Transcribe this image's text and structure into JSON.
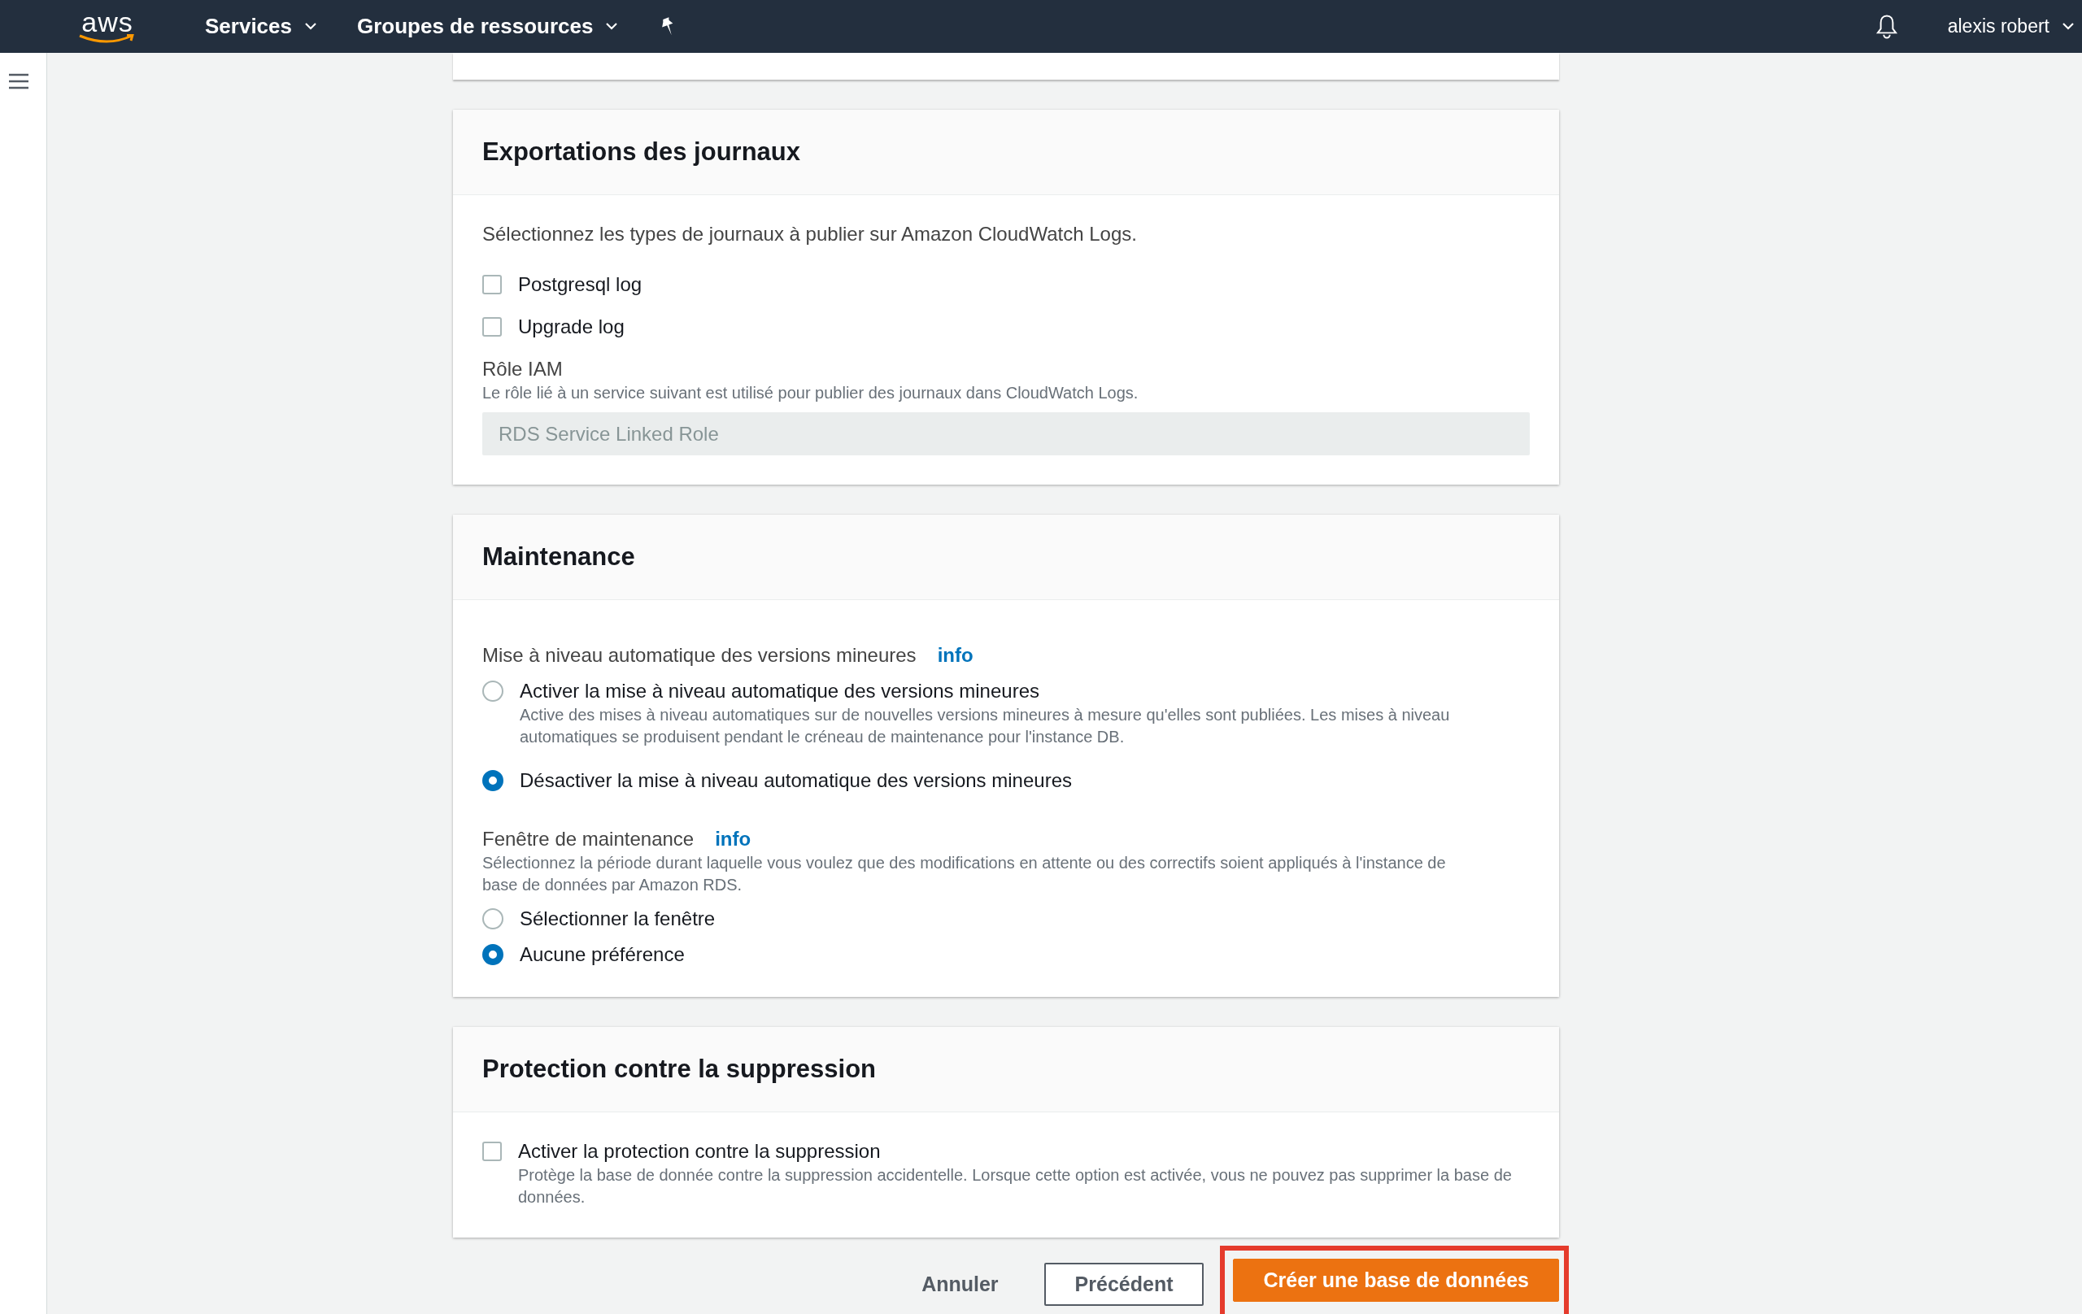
{
  "top_nav": {
    "logo": "aws",
    "menus": [
      {
        "label": "Services"
      },
      {
        "label": "Groupes de ressources"
      }
    ],
    "user": "alexis robert"
  },
  "sections": [
    {
      "title": "Exportations des journaux",
      "blocks": [
        {
          "kind": "text",
          "text": "Sélectionnez les types de journaux à publier sur Amazon CloudWatch Logs."
        },
        {
          "kind": "checkbox",
          "label": "Postgresql log",
          "checked": false
        },
        {
          "kind": "checkbox",
          "label": "Upgrade log",
          "checked": false
        },
        {
          "kind": "field",
          "label": "Rôle IAM",
          "hint": "Le rôle lié à un service suivant est utilisé pour publier des journaux dans CloudWatch Logs.",
          "value": "RDS Service Linked Role"
        }
      ]
    },
    {
      "title": "Maintenance",
      "blocks": [
        {
          "kind": "radio_group",
          "label": "Mise à niveau automatique des versions mineures",
          "info": "info",
          "options": [
            {
              "label": "Activer la mise à niveau automatique des versions mineures",
              "description": "Active des mises à niveau automatiques sur de nouvelles versions mineures à mesure qu'elles sont publiées. Les mises à niveau automatiques se produisent pendant le créneau de maintenance pour l'instance DB.",
              "selected": false
            },
            {
              "label": "Désactiver la mise à niveau automatique des versions mineures",
              "selected": true
            }
          ]
        },
        {
          "kind": "radio_group",
          "label": "Fenêtre de maintenance",
          "info": "info",
          "hint": "Sélectionnez la période durant laquelle vous voulez que des modifications en attente ou des correctifs soient appliqués à l'instance de base de données par Amazon RDS.",
          "options": [
            {
              "label": "Sélectionner la fenêtre",
              "selected": false
            },
            {
              "label": "Aucune préférence",
              "selected": true
            }
          ]
        }
      ]
    },
    {
      "title": "Protection contre la suppression",
      "blocks": [
        {
          "kind": "checkbox",
          "label": "Activer la protection contre la suppression",
          "description": "Protège la base de donnée contre la suppression accidentelle. Lorsque cette option est activée, vous ne pouvez pas supprimer la base de données.",
          "checked": false
        }
      ]
    }
  ],
  "actions": [
    {
      "kind": "link",
      "label": "Annuler"
    },
    {
      "kind": "secondary",
      "label": "Précédent"
    },
    {
      "kind": "primary",
      "label": "Créer une base de données",
      "highlighted": true
    }
  ]
}
